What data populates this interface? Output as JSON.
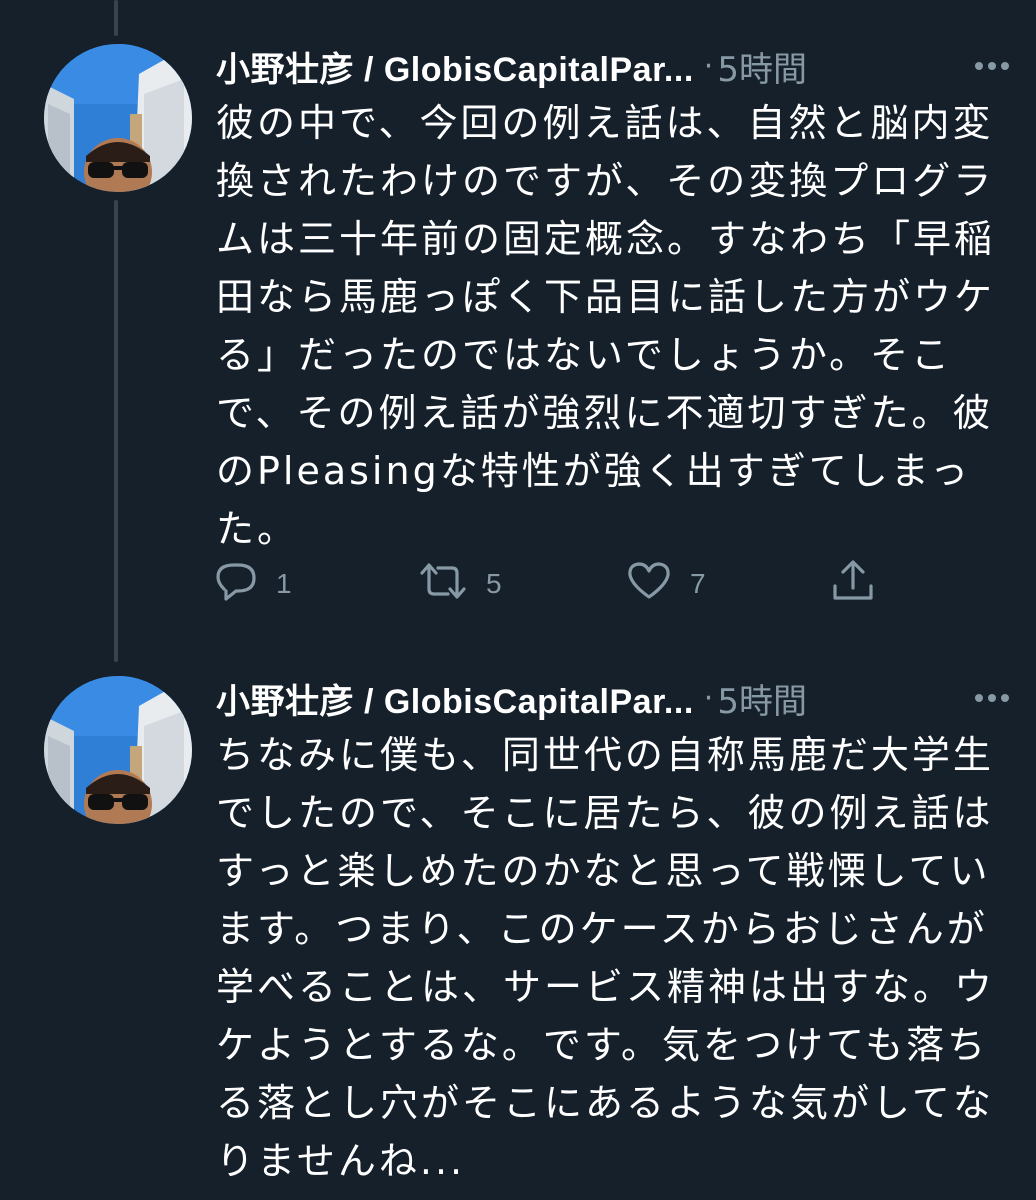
{
  "tweets": [
    {
      "author": "小野壮彦 / GlobisCapitalPar...",
      "separator": "·",
      "time": "5時間",
      "text": "彼の中で、今回の例え話は、自然と脳内変換されたわけのですが、その変換プログラムは三十年前の固定概念。すなわち「早稲田なら馬鹿っぽく下品目に話した方がウケる」だったのではないでしょうか。そこで、その例え話が強烈に不適切すぎた。彼のPleasingな特性が強く出すぎてしまった。",
      "reply_count": "1",
      "retweet_count": "5",
      "like_count": "7"
    },
    {
      "author": "小野壮彦 / GlobisCapitalPar...",
      "separator": "·",
      "time": "5時間",
      "text": "ちなみに僕も、同世代の自称馬鹿だ大学生でしたので、そこに居たら、彼の例え話はすっと楽しめたのかなと思って戦慄しています。つまり、このケースからおじさんが学べることは、サービス精神は出すな。ウケようとするな。です。気をつけても落ちる落とし穴がそこにあるような気がしてなりませんね..."
    }
  ],
  "icons": {
    "more": "more-icon",
    "reply": "reply-icon",
    "retweet": "retweet-icon",
    "like": "like-icon",
    "share": "share-icon"
  },
  "colors": {
    "background": "#15202b",
    "secondary_text": "#8899a6",
    "thread_line": "#38444d"
  }
}
